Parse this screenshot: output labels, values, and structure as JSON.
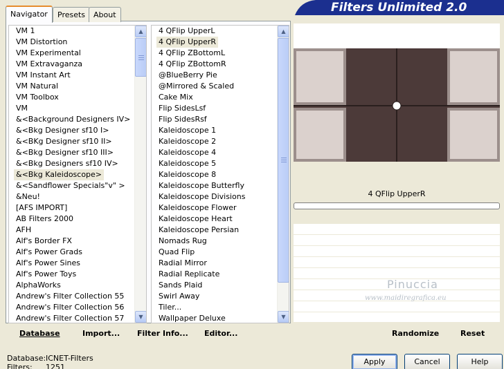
{
  "tabs": [
    {
      "label": "Navigator",
      "active": true
    },
    {
      "label": "Presets",
      "active": false
    },
    {
      "label": "About",
      "active": false
    }
  ],
  "banner": {
    "title": "Filters Unlimited 2.0",
    "color": "#1b2f8f"
  },
  "categories": {
    "items": [
      "VM 1",
      "VM Distortion",
      "VM Experimental",
      "VM Extravaganza",
      "VM Instant Art",
      "VM Natural",
      "VM Toolbox",
      "VM",
      "&<Background Designers IV>",
      "&<Bkg Designer sf10 I>",
      "&<BKg Designer sf10 II>",
      "&<Bkg Designer sf10 III>",
      "&<Bkg Designers sf10 IV>",
      "&<Bkg Kaleidoscope>",
      "&<Sandflower Specials\"v\" >",
      "&Neu!",
      "[AFS IMPORT]",
      "AB Filters 2000",
      "AFH",
      "Alf's Border FX",
      "Alf's Power Grads",
      "Alf's Power Sines",
      "Alf's Power Toys",
      "AlphaWorks",
      "Andrew's Filter Collection 55",
      "Andrew's Filter Collection 56",
      "Andrew's Filter Collection 57"
    ],
    "selected_index": 13
  },
  "filters": {
    "items": [
      "4 QFlip UpperL",
      "4 QFlip UpperR",
      "4 QFlip ZBottomL",
      "4 QFlip ZBottomR",
      "@BlueBerry Pie",
      "@Mirrored & Scaled",
      "Cake Mix",
      "Flip SidesLsf",
      "Flip SidesRsf",
      "Kaleidoscope 1",
      "Kaleidoscope 2",
      "Kaleidoscope 4",
      "Kaleidoscope 5",
      "Kaleidoscope 8",
      "Kaleidoscope Butterfly",
      "Kaleidoscope Divisions",
      "Kaleidoscope Flower",
      "Kaleidoscope Heart",
      "Kaleidoscope Persian",
      "Nomads Rug",
      "Quad Flip",
      "Radial Mirror",
      "Radial Replicate",
      "Sands Plaid",
      "Swirl Away",
      "Tiler...",
      "Wallpaper Deluxe"
    ],
    "selected_index": 1
  },
  "preview": {
    "selected_filter_name": "4 QFlip UpperR"
  },
  "watermark": {
    "name": "Pinuccia",
    "site": "www.maidiregrafica.eu"
  },
  "bottom_links": {
    "database": "Database",
    "import": "Import...",
    "filter_info": "Filter Info...",
    "editor": "Editor...",
    "randomize": "Randomize",
    "reset": "Reset"
  },
  "info": {
    "database_label": "Database:",
    "database_value": "ICNET-Filters",
    "filters_label": "Filters:",
    "filters_value": "1251"
  },
  "buttons": {
    "apply": "Apply",
    "cancel": "Cancel",
    "help": "Help"
  }
}
